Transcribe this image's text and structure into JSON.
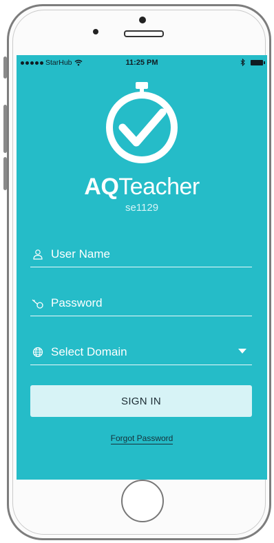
{
  "status_bar": {
    "carrier": "StarHub",
    "time": "11:25 PM"
  },
  "brand": {
    "name_bold": "AQ",
    "name_regular": "Teacher",
    "school_code": "se1129"
  },
  "form": {
    "username_placeholder": "User Name",
    "password_placeholder": "Password",
    "domain_placeholder": "Select Domain",
    "signin_label": "SIGN IN",
    "forgot_label": "Forgot Password"
  },
  "colors": {
    "screen_background": "#25bcc8",
    "button_background": "#d7f3f6"
  }
}
